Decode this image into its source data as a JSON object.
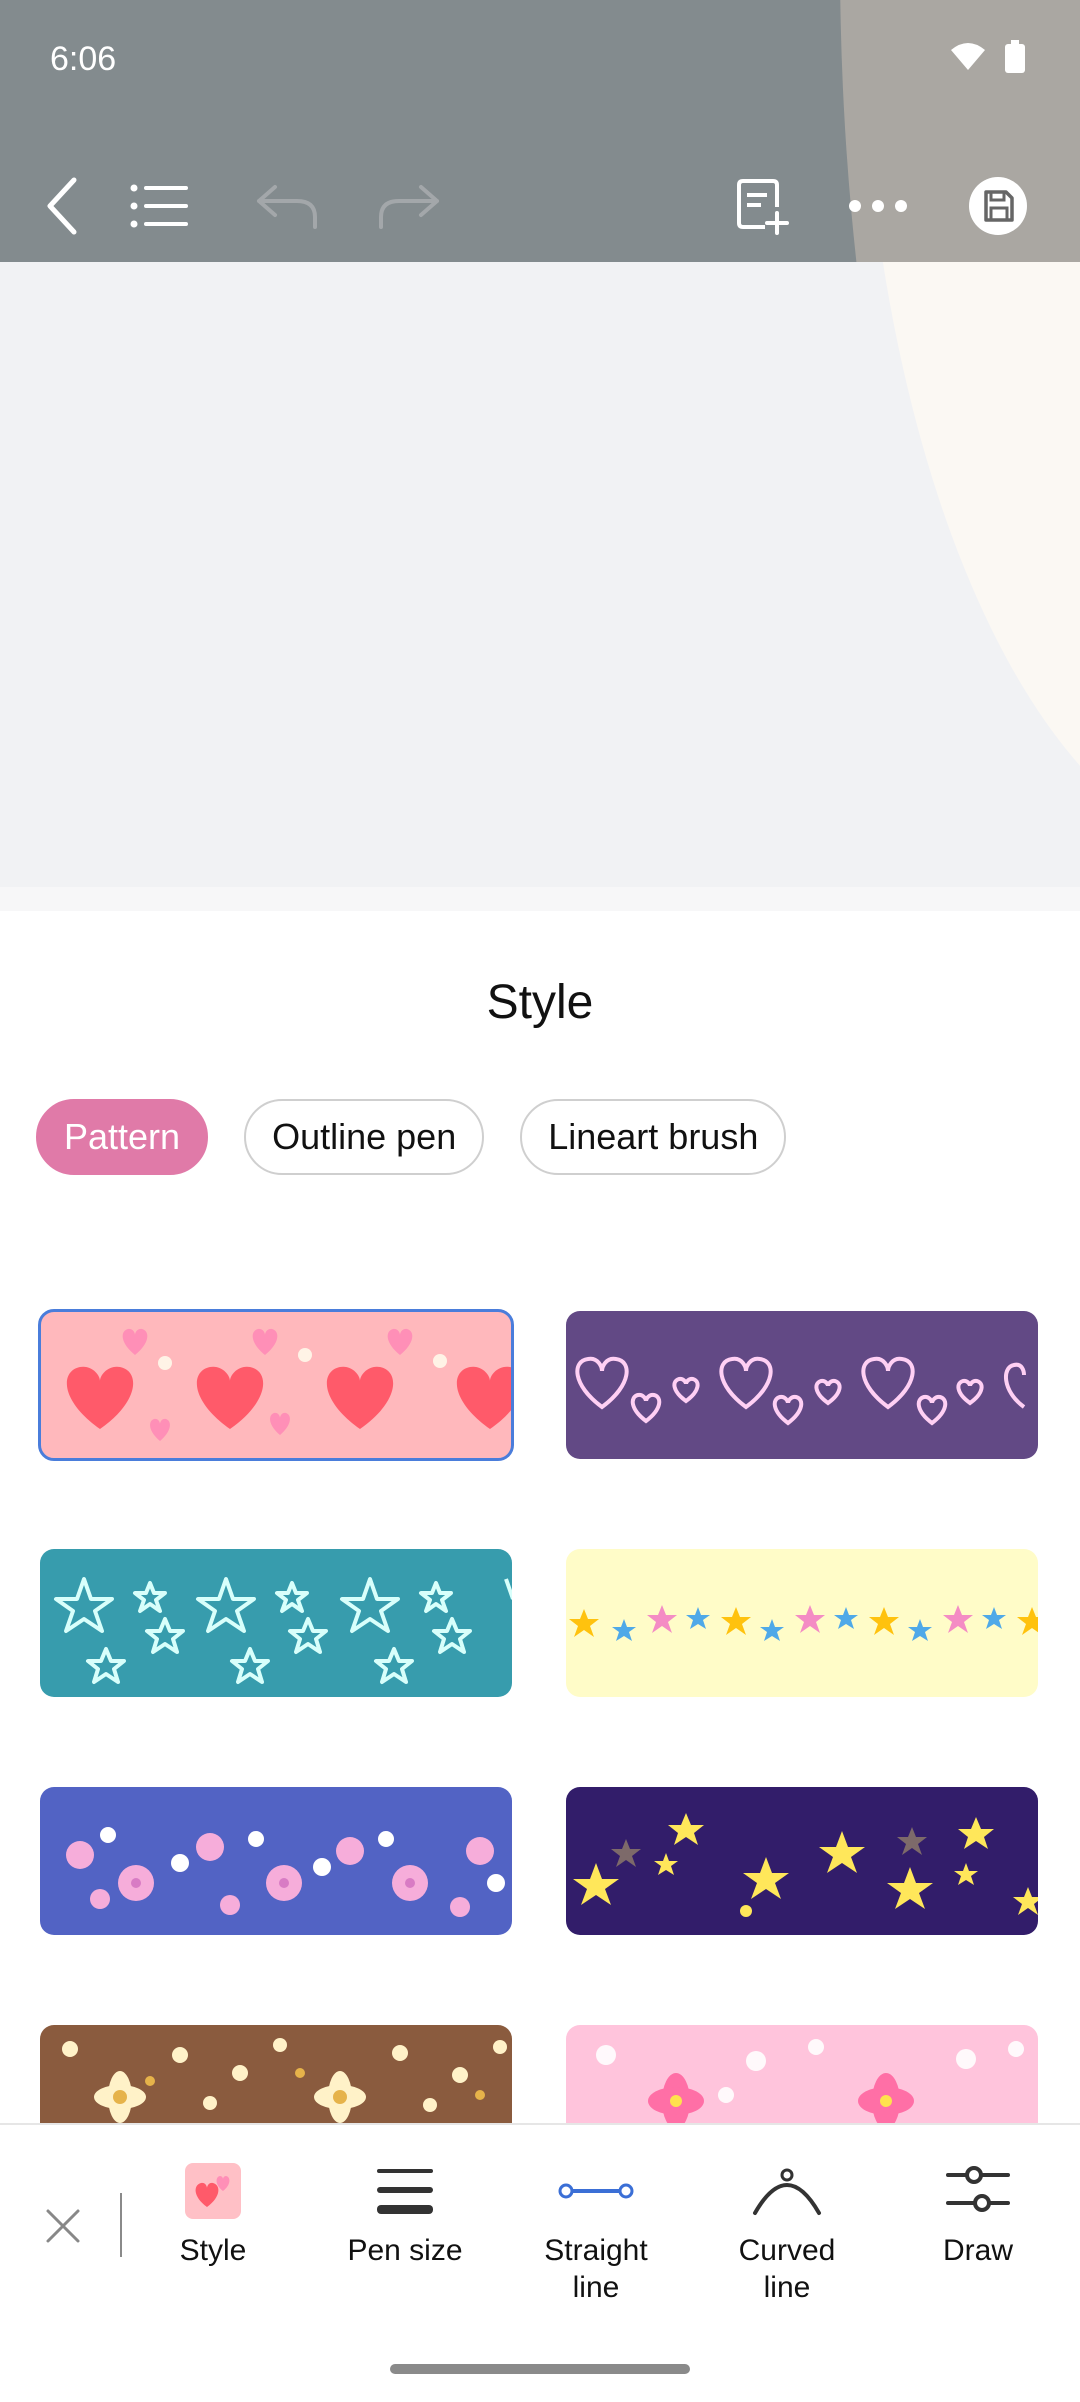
{
  "status": {
    "time": "6:06",
    "icons": [
      "wifi-icon",
      "battery-icon"
    ]
  },
  "toolbar": {
    "icons": [
      "back-icon",
      "list-icon",
      "undo-icon",
      "redo-icon",
      "new-page-icon",
      "more-icon",
      "save-icon"
    ]
  },
  "sheet": {
    "title": "Style",
    "tabs": [
      {
        "label": "Pattern",
        "selected": true
      },
      {
        "label": "Outline pen",
        "selected": false
      },
      {
        "label": "Lineart brush",
        "selected": false
      }
    ],
    "patterns": [
      {
        "name": "pink-hearts",
        "bg": "#ffb8bc",
        "fg": "#ff5a6a",
        "selected": true
      },
      {
        "name": "neon-hearts",
        "bg": "#624985",
        "fg": "#ffb6ef"
      },
      {
        "name": "neon-stars",
        "bg": "#379cad",
        "fg": "#b9fff8"
      },
      {
        "name": "pastel-stars",
        "bg": "#fffcc8",
        "fg": "#ffcb15"
      },
      {
        "name": "sakura-blue",
        "bg": "#5263c4",
        "fg": "#ff9ed3"
      },
      {
        "name": "gold-stars",
        "bg": "#321d6a",
        "fg": "#ffe75a"
      },
      {
        "name": "white-flowers",
        "bg": "#8a5b3e",
        "fg": "#fff7d6"
      },
      {
        "name": "pink-flowers",
        "bg": "#ffc4dc",
        "fg": "#ff6fa6"
      }
    ]
  },
  "bottom_tools": {
    "close_icon": "close-icon",
    "items": [
      {
        "label": "Style",
        "icon": "style-icon"
      },
      {
        "label": "Pen size",
        "icon": "pen-size-icon"
      },
      {
        "label": "Straight line",
        "icon": "straight-line-icon",
        "active": true
      },
      {
        "label": "Curved line",
        "icon": "curved-line-icon"
      },
      {
        "label": "Draw",
        "icon": "draw-icon"
      }
    ]
  },
  "colors": {
    "accent": "#e07aa8",
    "selected_outline": "#4a7ddb",
    "active_tool": "#3b6fd6"
  }
}
